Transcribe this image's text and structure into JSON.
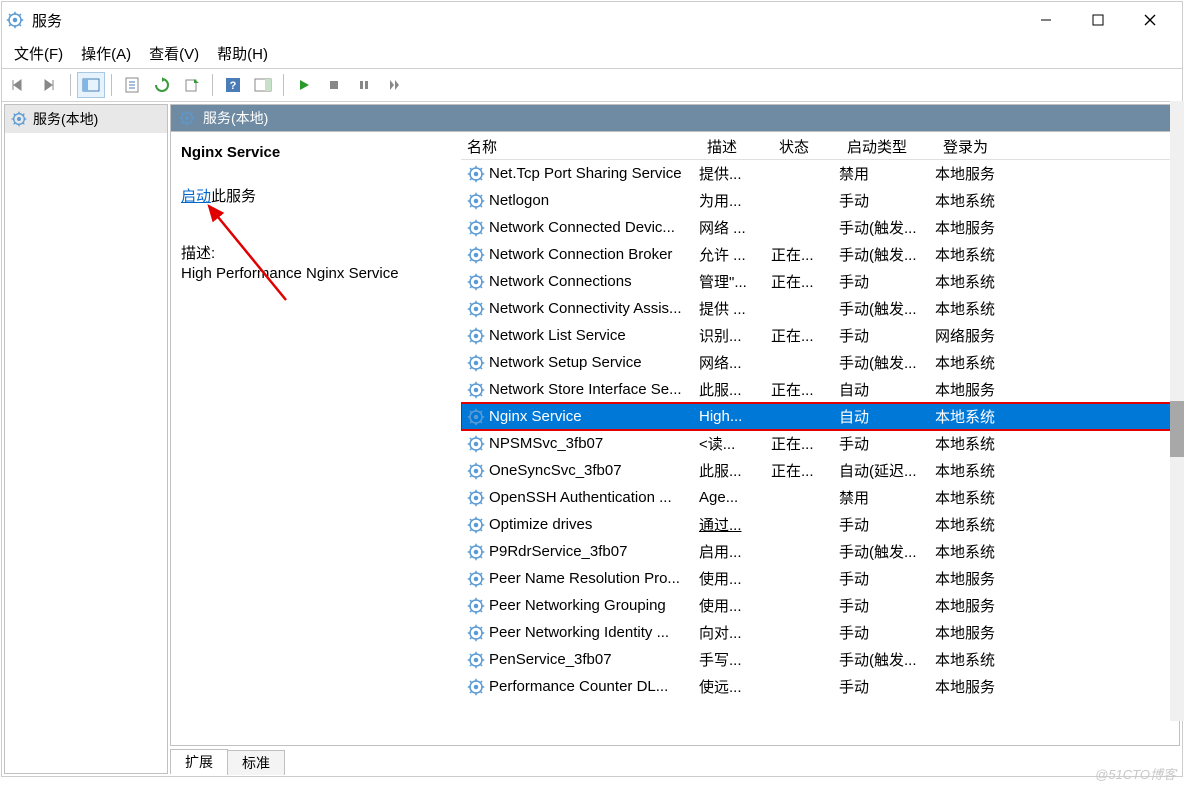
{
  "window": {
    "title": "服务"
  },
  "menus": {
    "file": "文件(F)",
    "action": "操作(A)",
    "view": "查看(V)",
    "help": "帮助(H)"
  },
  "left": {
    "local": "服务(本地)"
  },
  "header": {
    "title": "服务(本地)"
  },
  "detail": {
    "name": "Nginx Service",
    "start": "启动",
    "start_suffix": "此服务",
    "desc_label": "描述:",
    "desc": "High Performance Nginx Service"
  },
  "columns": {
    "name": "名称",
    "desc": "描述",
    "status": "状态",
    "start": "启动类型",
    "logon": "登录为"
  },
  "services": [
    {
      "name": "Net.Tcp Port Sharing Service",
      "desc": "提供...",
      "status": "",
      "start": "禁用",
      "logon": "本地服务"
    },
    {
      "name": "Netlogon",
      "desc": "为用...",
      "status": "",
      "start": "手动",
      "logon": "本地系统"
    },
    {
      "name": "Network Connected Devic...",
      "desc": "网络 ...",
      "status": "",
      "start": "手动(触发...",
      "logon": "本地服务"
    },
    {
      "name": "Network Connection Broker",
      "desc": "允许 ...",
      "status": "正在...",
      "start": "手动(触发...",
      "logon": "本地系统"
    },
    {
      "name": "Network Connections",
      "desc": "管理\"...",
      "status": "正在...",
      "start": "手动",
      "logon": "本地系统"
    },
    {
      "name": "Network Connectivity Assis...",
      "desc": "提供 ...",
      "status": "",
      "start": "手动(触发...",
      "logon": "本地系统"
    },
    {
      "name": "Network List Service",
      "desc": "识别...",
      "status": "正在...",
      "start": "手动",
      "logon": "网络服务"
    },
    {
      "name": "Network Setup Service",
      "desc": "网络...",
      "status": "",
      "start": "手动(触发...",
      "logon": "本地系统"
    },
    {
      "name": "Network Store Interface Se...",
      "desc": "此服...",
      "status": "正在...",
      "start": "自动",
      "logon": "本地服务"
    },
    {
      "name": "Nginx Service",
      "desc": "High...",
      "status": "",
      "start": "自动",
      "logon": "本地系统",
      "selected": true
    },
    {
      "name": "NPSMSvc_3fb07",
      "desc": "<读...",
      "status": "正在...",
      "start": "手动",
      "logon": "本地系统"
    },
    {
      "name": "OneSyncSvc_3fb07",
      "desc": "此服...",
      "status": "正在...",
      "start": "自动(延迟...",
      "logon": "本地系统"
    },
    {
      "name": "OpenSSH Authentication ...",
      "desc": "Age...",
      "status": "",
      "start": "禁用",
      "logon": "本地系统"
    },
    {
      "name": "Optimize drives",
      "desc": "通过...",
      "status": "",
      "start": "手动",
      "logon": "本地系统",
      "ul": true
    },
    {
      "name": "P9RdrService_3fb07",
      "desc": "启用...",
      "status": "",
      "start": "手动(触发...",
      "logon": "本地系统"
    },
    {
      "name": "Peer Name Resolution Pro...",
      "desc": "使用...",
      "status": "",
      "start": "手动",
      "logon": "本地服务"
    },
    {
      "name": "Peer Networking Grouping",
      "desc": "使用...",
      "status": "",
      "start": "手动",
      "logon": "本地服务"
    },
    {
      "name": "Peer Networking Identity ...",
      "desc": "向对...",
      "status": "",
      "start": "手动",
      "logon": "本地服务"
    },
    {
      "name": "PenService_3fb07",
      "desc": "手写...",
      "status": "",
      "start": "手动(触发...",
      "logon": "本地系统"
    },
    {
      "name": "Performance Counter DL...",
      "desc": "使远...",
      "status": "",
      "start": "手动",
      "logon": "本地服务"
    }
  ],
  "tabs": {
    "extended": "扩展",
    "standard": "标准"
  },
  "watermark": "@51CTO博客"
}
